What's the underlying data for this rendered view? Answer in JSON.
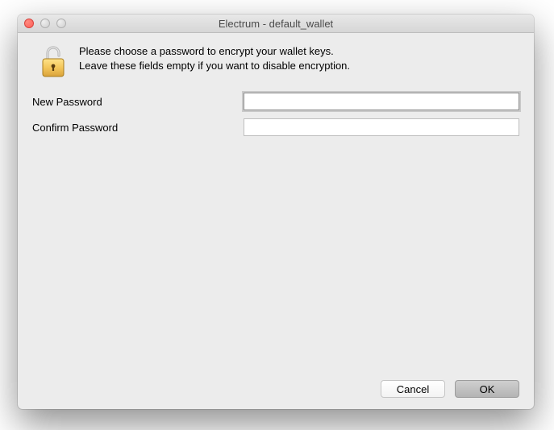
{
  "window": {
    "title": "Electrum  -  default_wallet"
  },
  "dialog": {
    "instruction_line1": "Please choose a password to encrypt your wallet keys.",
    "instruction_line2": "Leave these fields empty if you want to disable encryption.",
    "new_password_label": "New Password",
    "confirm_password_label": "Confirm Password",
    "new_password_value": "",
    "confirm_password_value": ""
  },
  "buttons": {
    "cancel": "Cancel",
    "ok": "OK"
  }
}
